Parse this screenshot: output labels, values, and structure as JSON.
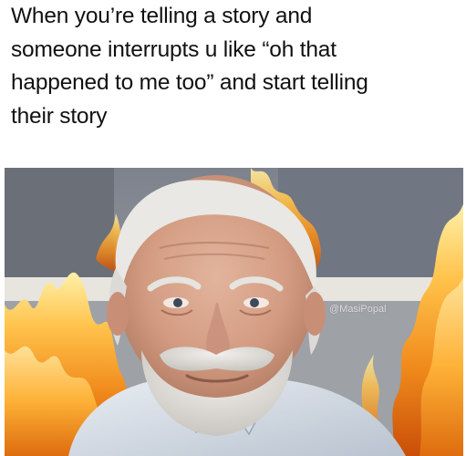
{
  "caption": {
    "lines": [
      "When you’re telling a story and",
      "someone interrupts u like “oh that",
      "happened to me too” and start telling",
      "their story"
    ]
  },
  "photo": {
    "subject": "elderly man with white beard smiling awkwardly",
    "effect": "flames overlay",
    "watermark": "@MasiPopal"
  }
}
